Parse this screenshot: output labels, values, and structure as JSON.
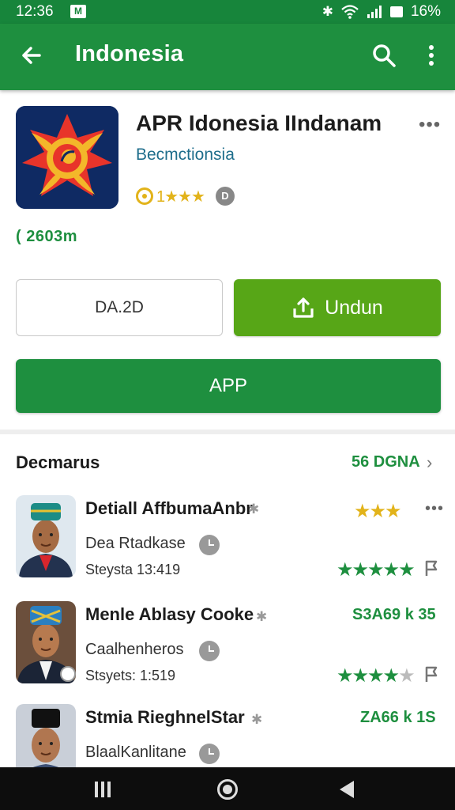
{
  "status_bar": {
    "time": "12:36",
    "battery": "16%"
  },
  "app_bar": {
    "title": "Indonesia"
  },
  "app": {
    "name": "APR Idonesia IIndanam",
    "developer": "Becmctionsia",
    "rating_stars": "1★★★",
    "age_badge": "D",
    "downloads": "( 2603m",
    "price_label": "DA.2D",
    "install_label": "Undun",
    "app_label": "APP"
  },
  "section": {
    "title": "Decmarus",
    "more": "56 DGNA"
  },
  "items": [
    {
      "name": "Detiall AffbumaAnbr",
      "sub": "Dea Rtadkase",
      "meta": "Steysta 13:419",
      "right_top": "",
      "top_stars": "★★★",
      "rating_text": "★★★★★"
    },
    {
      "name": "Menle Ablasy Cooke",
      "sub": "Caalhenheros",
      "meta": "Stsyets: 1:519",
      "right_top": "S3A69 k 35",
      "rating_text": "★★★★"
    },
    {
      "name": "Stmia RieghnelStar",
      "sub": "BlaalKanlitane",
      "meta": "",
      "right_top": "ZA66 k 1S",
      "rating_text": ""
    }
  ],
  "colors": {
    "primary": "#1e8f3f",
    "status_bar": "#17853b",
    "install": "#57a617",
    "star_gold": "#e2b31a"
  }
}
